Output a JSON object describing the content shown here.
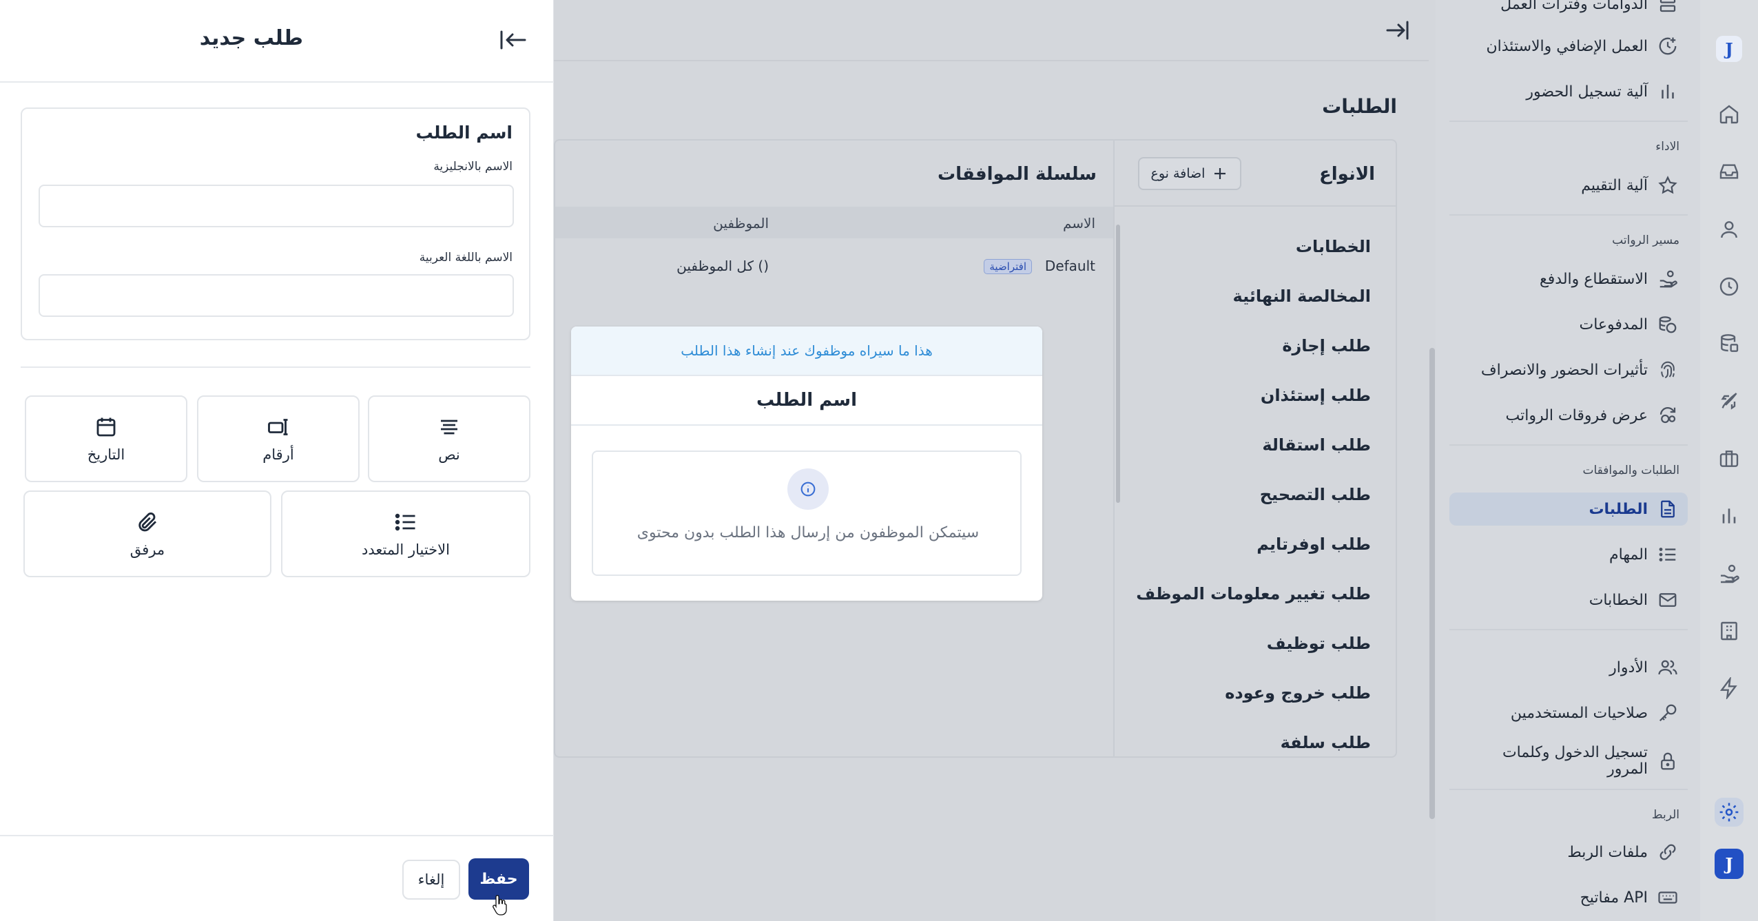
{
  "drawer": {
    "title": "طلب جديد",
    "name_card_title": "اسم الطلب",
    "english_label": "الاسم بالانجليزية",
    "english_value": "",
    "arabic_label": "الاسم باللغة العربية",
    "arabic_value": "",
    "field_types": [
      {
        "label": "نص",
        "icon": "text-lines-icon"
      },
      {
        "label": "أرقام",
        "icon": "numbers-icon"
      },
      {
        "label": "التاريخ",
        "icon": "calendar-icon"
      },
      {
        "label": "الاختيار المتعدد",
        "icon": "list-icon"
      },
      {
        "label": "مرفق",
        "icon": "paperclip-icon"
      }
    ],
    "save_label": "حفظ",
    "cancel_label": "إلغاء"
  },
  "preview": {
    "hint": "هذا ما سيراه موظفوك عند إنشاء هذا الطلب",
    "title": "اسم الطلب",
    "empty_text": "سيتمكن الموظفون من إرسال هذا الطلب بدون محتوى"
  },
  "main": {
    "page_title": "الطلبات",
    "types_title": "الانواع",
    "add_type_label": "اضافة نوع",
    "types": [
      "الخطابات",
      "المخالصة النهائية",
      "طلب إجازة",
      "طلب إستئذان",
      "طلب استقالة",
      "طلب التصحيح",
      "طلب اوفرتايم",
      "طلب تغيير معلومات الموظف",
      "طلب توظيف",
      "طلب خروج وعوده",
      "طلب سلفة"
    ],
    "chain_title": "سلسلة الموافقات",
    "chain_headers": {
      "name": "الاسم",
      "employees": "الموظفين"
    },
    "chain_rows": [
      {
        "name": "Default",
        "badge": "افتراضية",
        "employees": "كل الموظفين ()"
      }
    ]
  },
  "sidebar": {
    "items_top": [
      {
        "label": "الدوامات وفترات العمل",
        "icon": "shifts-icon"
      },
      {
        "label": "العمل الإضافي والاستئذان",
        "icon": "clock-plus-icon"
      },
      {
        "label": "آلية تسجيل الحضور",
        "icon": "bar-chart-icon"
      }
    ],
    "performance_section": "الاداء",
    "performance_items": [
      {
        "label": "آلية التقييم",
        "icon": "star-icon"
      }
    ],
    "payroll_section": "مسير الرواتب",
    "payroll_items": [
      {
        "label": "الاستقطاع والدفع",
        "icon": "hand-coins-icon"
      },
      {
        "label": "المدفوعات",
        "icon": "coins-icon"
      },
      {
        "label": "تأثيرات الحضور والانصراف",
        "icon": "fingerprint-icon"
      },
      {
        "label": "عرض فروقات الرواتب",
        "icon": "refresh-coins-icon"
      }
    ],
    "requests_section": "الطلبات والموافقات",
    "requests_items": [
      {
        "label": "الطلبات",
        "icon": "document-icon",
        "active": true
      },
      {
        "label": "المهام",
        "icon": "list-icon"
      },
      {
        "label": "الخطابات",
        "icon": "envelope-icon"
      }
    ],
    "access_items": [
      {
        "label": "الأدوار",
        "icon": "users-icon"
      },
      {
        "label": "صلاحيات المستخدمين",
        "icon": "key-icon"
      },
      {
        "label": "تسجيل الدخول وكلمات المرور",
        "icon": "lock-icon"
      }
    ],
    "integration_section": "الربط",
    "integration_items": [
      {
        "label": "ملفات الربط",
        "icon": "link-icon"
      },
      {
        "label": "مفاتيح API",
        "icon": "keyboard-icon"
      }
    ]
  },
  "rail": {
    "logo_letter": "J",
    "icons": [
      "home-icon",
      "inbox-icon",
      "user-icon",
      "clock-icon",
      "database-icon",
      "rocket-icon",
      "briefcase-icon",
      "bar-chart-icon",
      "hand-coins-icon",
      "building-icon",
      "lightning-icon",
      "gear-icon"
    ]
  },
  "colors": {
    "primary": "#1d3b8f",
    "hint": "#2e8cd6",
    "badge_bg": "#c3cde6"
  }
}
